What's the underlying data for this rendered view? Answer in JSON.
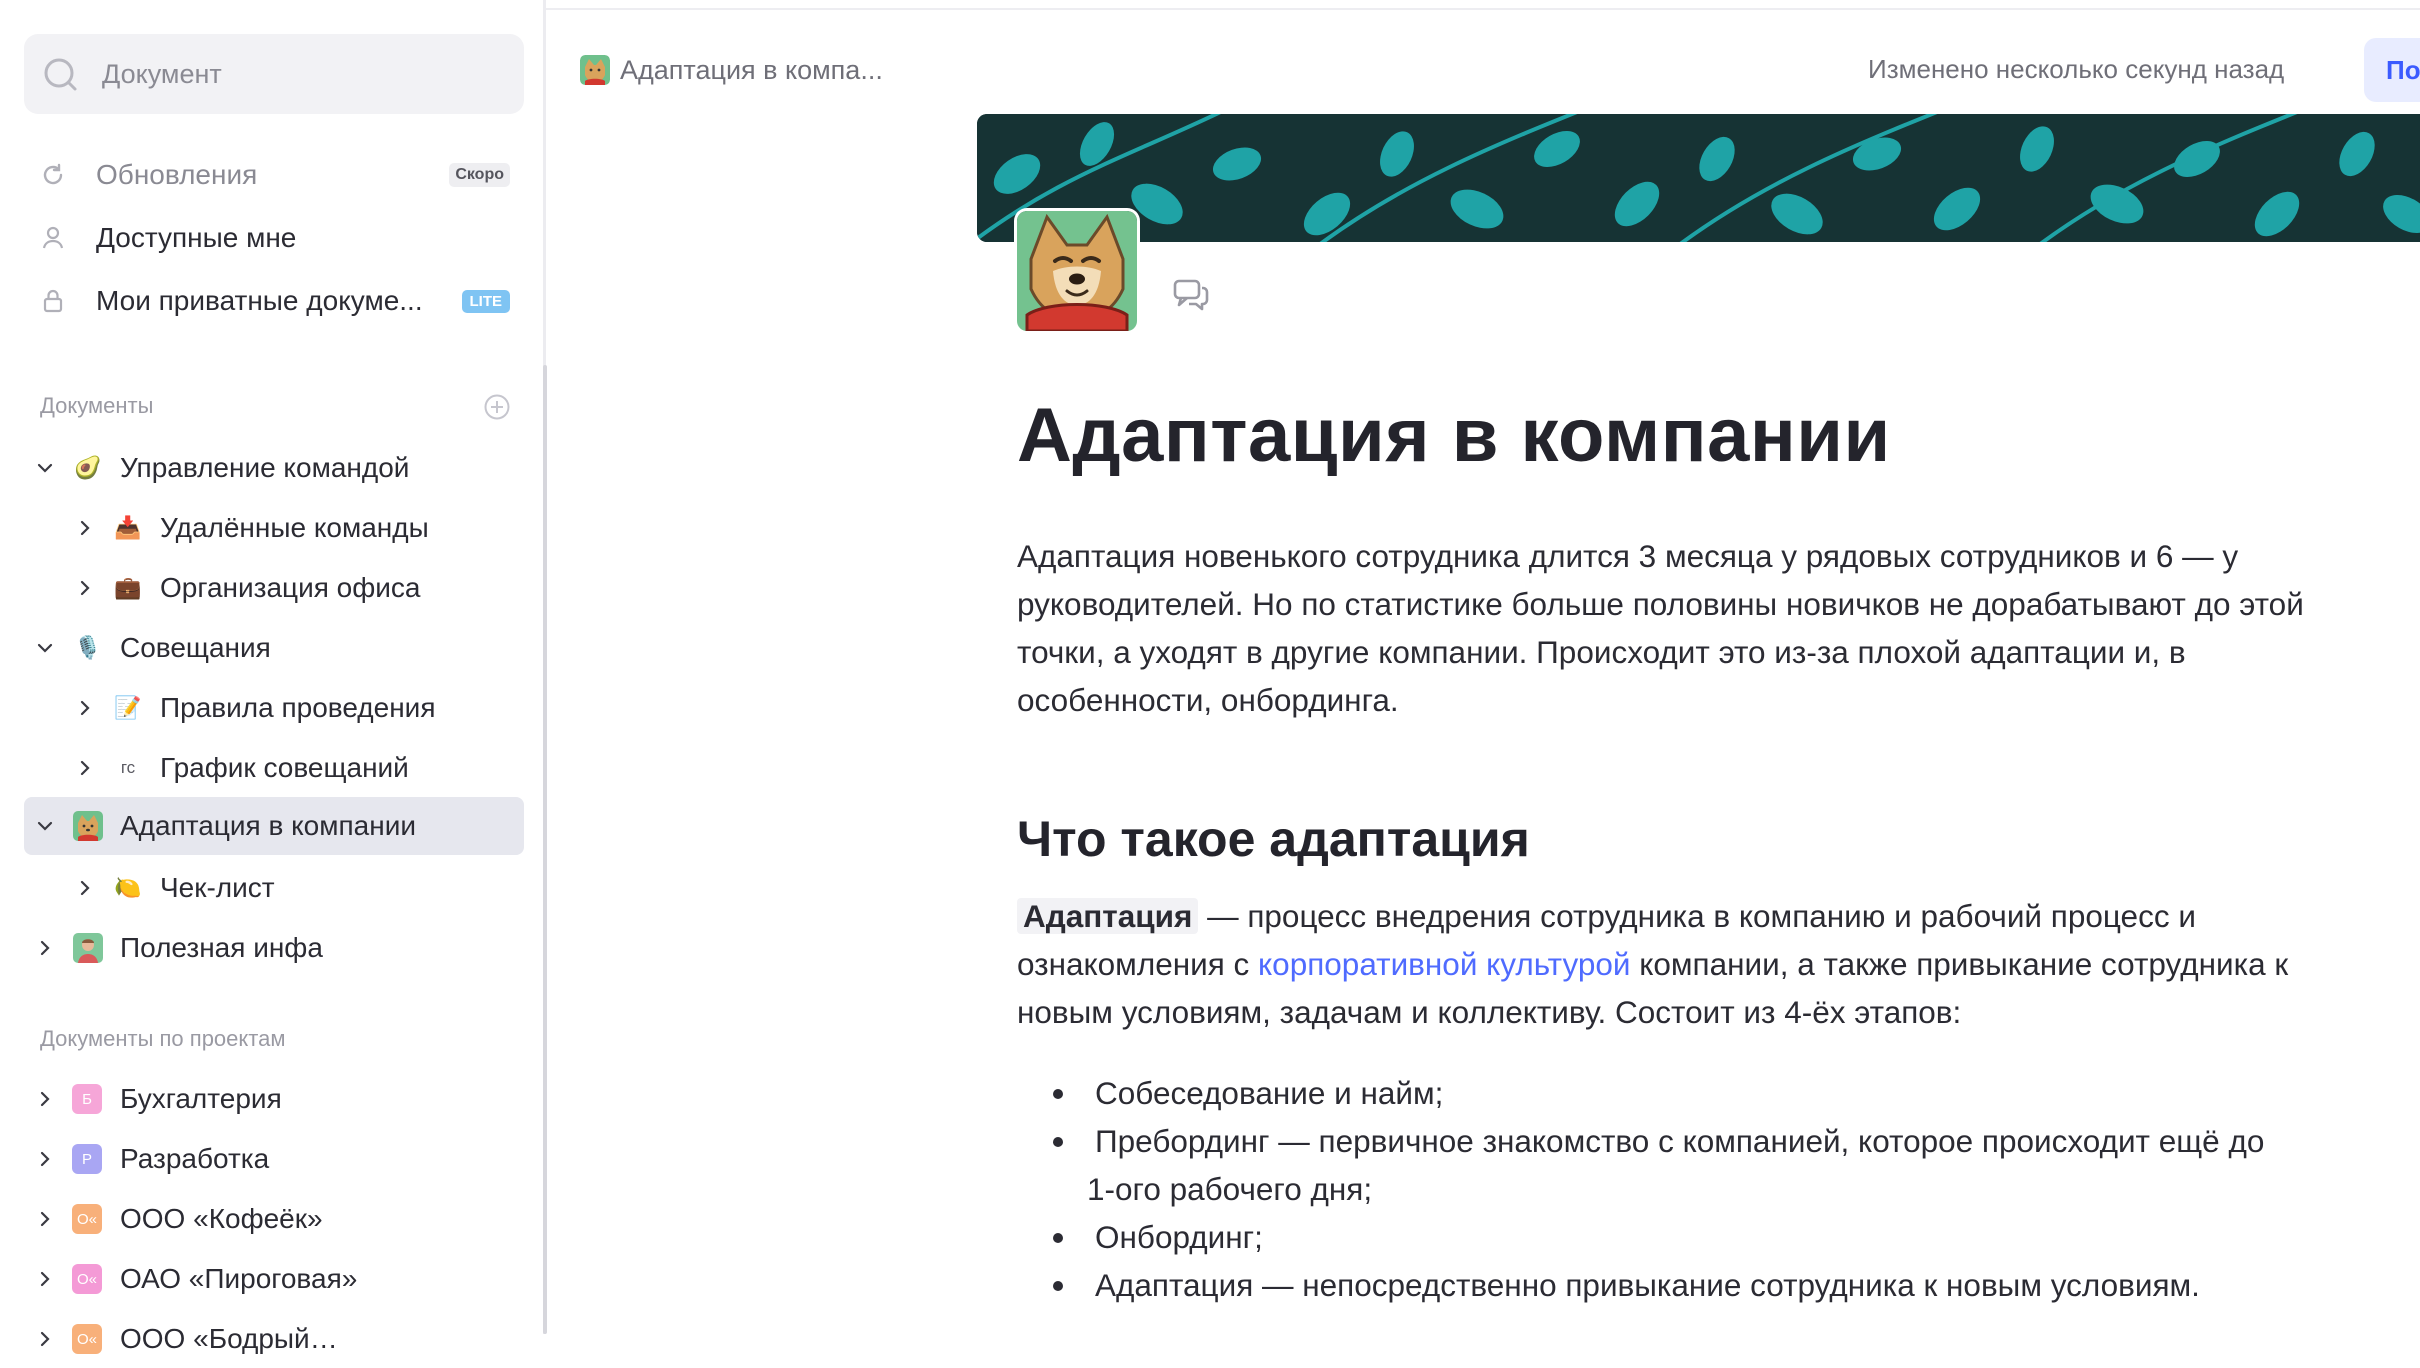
{
  "search": {
    "placeholder": "Документ"
  },
  "nav": {
    "updates": {
      "label": "Обновления",
      "badge": "Скоро"
    },
    "shared": {
      "label": "Доступные мне"
    },
    "private": {
      "label": "Мои приватные докуме...",
      "badge": "LITE"
    }
  },
  "documents": {
    "title": "Документы",
    "items": [
      {
        "label": "Управление командой",
        "emoji": "🥑"
      },
      {
        "label": "Удалённые команды",
        "emoji": "📥"
      },
      {
        "label": "Организация офиса",
        "emoji": "💼"
      },
      {
        "label": "Совещания",
        "emoji": "🎙️"
      },
      {
        "label": "Правила проведения",
        "emoji": "📝"
      },
      {
        "label": "График совещаний",
        "icon_text": "ГС"
      },
      {
        "label": "Адаптация в компании"
      },
      {
        "label": "Чек-лист",
        "emoji": "🍋"
      },
      {
        "label": "Полезная инфа"
      }
    ]
  },
  "projects": {
    "title": "Документы по проектам",
    "items": [
      {
        "label": "Бухгалтерия",
        "letter": "Б",
        "color": "#f6a6d8"
      },
      {
        "label": "Разработка",
        "letter": "Р",
        "color": "#a9a6f3"
      },
      {
        "label": "ООО «Кофеёк»",
        "letter": "О«",
        "color": "#f8b07a"
      },
      {
        "label": "ОАО «Пироговая»",
        "letter": "О«",
        "color": "#f49ad6"
      },
      {
        "label": "ООО «Бодрый…",
        "letter": "О«",
        "color": "#f8b07a"
      }
    ]
  },
  "topbar": {
    "breadcrumb": "Адаптация в компа...",
    "modified": "Изменено несколько секунд назад",
    "share": "По"
  },
  "doc": {
    "title": "Адаптация в компании",
    "intro": "Адаптация новенького сотрудника длится 3 месяца у рядовых сотрудников и 6 — у руководителей. Но по статистике больше половины новичков не дорабатывают до этой точки, а уходят в другие компании. Происходит это из-за плохой адаптации и, в особенности, онбординга.",
    "h2": "Что такое адаптация",
    "def_bold": "Адаптация",
    "def_part1": " — процесс внедрения сотрудника в компанию и рабочий процесс и ознакомления с ",
    "def_link": "корпоративной культурой",
    "def_part2": " компании, а также привыкание сотрудника к новым условиям, задачам и коллективу. Состоит из 4-ёх этапов:",
    "bullets": [
      "Собеседование и найм;",
      "Пребординг — первичное знакомство с компанией, которое происходит ещё до",
      "1-ого рабочего дня;",
      "Онбординг;",
      "Адаптация — непосредственно привыкание сотрудника к новым условиям."
    ]
  },
  "colors": {
    "accent": "#4f6bff",
    "cover_bg": "#163334",
    "cover_leaf": "#1fa3a6",
    "selected_bg": "#e6e7ee"
  }
}
